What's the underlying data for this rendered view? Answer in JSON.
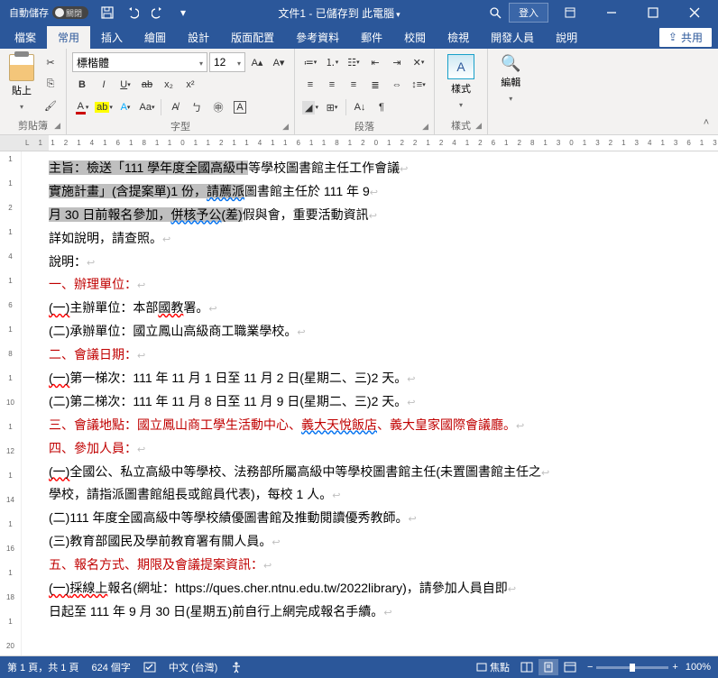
{
  "titlebar": {
    "autosave_label": "自動儲存",
    "autosave_state": "關閉",
    "doc_title": "文件1 - 已儲存到 此電腦",
    "login": "登入"
  },
  "tabs": {
    "file": "檔案",
    "home": "常用",
    "insert": "插入",
    "draw": "繪圖",
    "design": "設計",
    "layout": "版面配置",
    "references": "參考資料",
    "mailings": "郵件",
    "review": "校閱",
    "view": "檢視",
    "developer": "開發人員",
    "help": "說明",
    "share": "共用"
  },
  "ribbon": {
    "clipboard": {
      "paste": "貼上",
      "label": "剪貼簿"
    },
    "font": {
      "name": "標楷體",
      "size": "12",
      "label": "字型"
    },
    "paragraph": {
      "label": "段落"
    },
    "styles": {
      "btn": "樣式",
      "label": "樣式"
    },
    "editing": {
      "btn": "編輯"
    }
  },
  "ruler_marks": [
    "L",
    "1",
    "1",
    "2",
    "1",
    "4",
    "1",
    "6",
    "1",
    "8",
    "1",
    "10",
    "1",
    "12",
    "1",
    "14",
    "1",
    "16",
    "1",
    "18",
    "1",
    "20",
    "1",
    "22",
    "1",
    "24",
    "1",
    "26",
    "1",
    "28",
    "1",
    "30",
    "1",
    "32",
    "1",
    "34",
    "1",
    "36",
    "1",
    "38",
    "1",
    "40",
    "1",
    "42",
    "1",
    "44"
  ],
  "vruler_marks": [
    "1",
    "1",
    "2",
    "1",
    "4",
    "1",
    "6",
    "1",
    "8",
    "1",
    "10",
    "1",
    "12",
    "1",
    "14",
    "1",
    "16",
    "1",
    "18",
    "1",
    "20"
  ],
  "doc": {
    "p1a": "主旨：檢送「111 學年度全國高級中",
    "p1b": "等學校圖書館主任工作會議",
    "p2a": "實施計畫」(含提案單)1 份，",
    "p2b": "請薦派",
    "p2c": "圖書館主任於 111 年 9",
    "p3a": "月 30 日前報名參加，",
    "p3b": "併核予公",
    "p3c": "(差)",
    "p3d": "假與會，重要活動資訊",
    "p4": "詳如說明，請查照。",
    "p5": "說明：",
    "h1": "一、辦理單位：",
    "p6a": "(一)",
    "p6b": "主辦單位：本部",
    "p6c": "國教",
    "p6d": "署",
    "p6e": "。",
    "p7": "(二)承辦單位：國立鳳山高級商工職業學校。",
    "h2": "二、會議日期：",
    "p8a": "(一)",
    "p8b": "第一梯次：111 年 11 月 1 日至 11 月 2 日(星期二、三)2 天。",
    "p9": "(二)第二梯次：111 年 11 月 8 日至 11 月 9 日(星期二、三)2 天。",
    "h3a": "三、會議地點：國立鳳山商工學生活動中心、",
    "h3b": "義大天悅飯店",
    "h3c": "、義大皇家國際會議廳。",
    "h4": "四、參加人員：",
    "p10a": "(一)",
    "p10b": "全國公、私立高級中等學校、法務部所屬高級中等學校圖書館主任(未置圖書館主任之",
    "p11": "學校，請指派圖書館組長或館員代表)，每校 1 人。",
    "p12": "(二)111 年度全國高級中等學校績優圖書館及推動閱讀優秀教師。",
    "p13": "(三)教育部國民及學前教育署有關人員。",
    "h5": "五、報名方式、期限及會議提案資訊：",
    "p14a": "(一)",
    "p14b": "採線上",
    "p14c": "報名(網址：https://ques.cher.ntnu.edu.tw/2022library)，請參加人員自即",
    "p15": "日起至 111 年 9 月 30 日(星期五)前自行上網完成報名手續。"
  },
  "status": {
    "page": "第 1 頁，共 1 頁",
    "words": "624 個字",
    "lang_checked": "",
    "lang": "中文 (台灣)",
    "focus": "焦點",
    "zoom": "100%"
  }
}
